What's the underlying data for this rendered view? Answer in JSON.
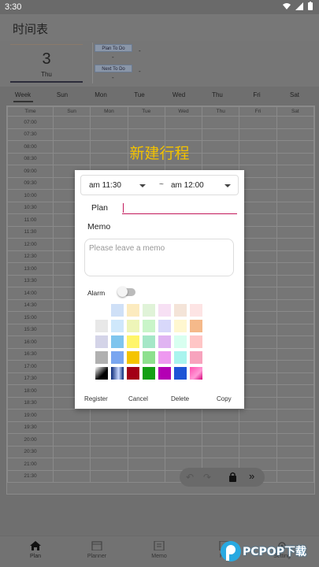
{
  "status_bar": {
    "time": "3:30"
  },
  "app": {
    "title": "时间表"
  },
  "summary": {
    "day_number": "3",
    "weekday": "Thu",
    "plan_to_do_label": "Plan To Do",
    "plan_to_do_value": "-",
    "next_to_do_label": "Next To Do",
    "next_to_do_value": "-",
    "dash1": "-",
    "dash2": "-"
  },
  "tabs": [
    "Week",
    "Sun",
    "Mon",
    "Tue",
    "Wed",
    "Thu",
    "Fri",
    "Sat"
  ],
  "grid": {
    "headers": [
      "Time",
      "Sun",
      "Mon",
      "Tue",
      "Wed",
      "Thu",
      "Fri",
      "Sat"
    ],
    "times": [
      "07:00",
      "07:30",
      "08:00",
      "08:30",
      "09:00",
      "09:30",
      "10:00",
      "10:30",
      "11:00",
      "11:30",
      "12:00",
      "12:30",
      "13:00",
      "13:30",
      "14:00",
      "14:30",
      "15:00",
      "15:30",
      "16:00",
      "16:30",
      "17:00",
      "17:30",
      "18:00",
      "18:30",
      "19:00",
      "19:30",
      "20:00",
      "20:30",
      "21:00",
      "21:30"
    ]
  },
  "dialog": {
    "title": "新建行程",
    "start_time": "am 11:30",
    "separator": "~",
    "end_time": "am 12:00",
    "plan_label": "Plan",
    "plan_value": "",
    "memo_label": "Memo",
    "memo_placeholder": "Please leave a memo",
    "alarm_label": "Alarm",
    "alarm_on": false,
    "actions": {
      "register": "Register",
      "cancel": "Cancel",
      "delete": "Delete",
      "copy": "Copy"
    }
  },
  "palette": [
    [
      "",
      "#cfe0f7",
      "#fcebbf",
      "#e0f3d8",
      "#f7e0f4",
      "#f4e4d8",
      "#fde4e4"
    ],
    [
      "#e8e8e8",
      "#cfe8fb",
      "#eef5b8",
      "#c9f5c9",
      "#d8d8fa",
      "#fff7d0",
      "#f5b98a"
    ],
    [
      "#d4d4e8",
      "#7fc5ee",
      "#fff56a",
      "#a5e7c7",
      "#e0b4f2",
      "#d8fff0",
      "#ffc6c6"
    ],
    [
      "#b0b0b0",
      "#7aa6f0",
      "#f5c400",
      "#8ee08e",
      "#ee99f0",
      "#a9f4ee",
      "#f7a3bd"
    ],
    [
      "gradient-black",
      "gradient-blue",
      "#a30016",
      "#14a014",
      "#b400b4",
      "#1f55d6",
      "gradient-pink"
    ]
  ],
  "bottom_nav": [
    {
      "label": "Plan",
      "icon": "home-icon"
    },
    {
      "label": "Planner",
      "icon": "calendar-icon"
    },
    {
      "label": "Memo",
      "icon": "notebook-icon"
    },
    {
      "label": "Pl...",
      "icon": "list-icon"
    },
    {
      "label": "Setting",
      "icon": "gear-icon"
    }
  ],
  "watermark": {
    "text": "PCPOP下载"
  }
}
